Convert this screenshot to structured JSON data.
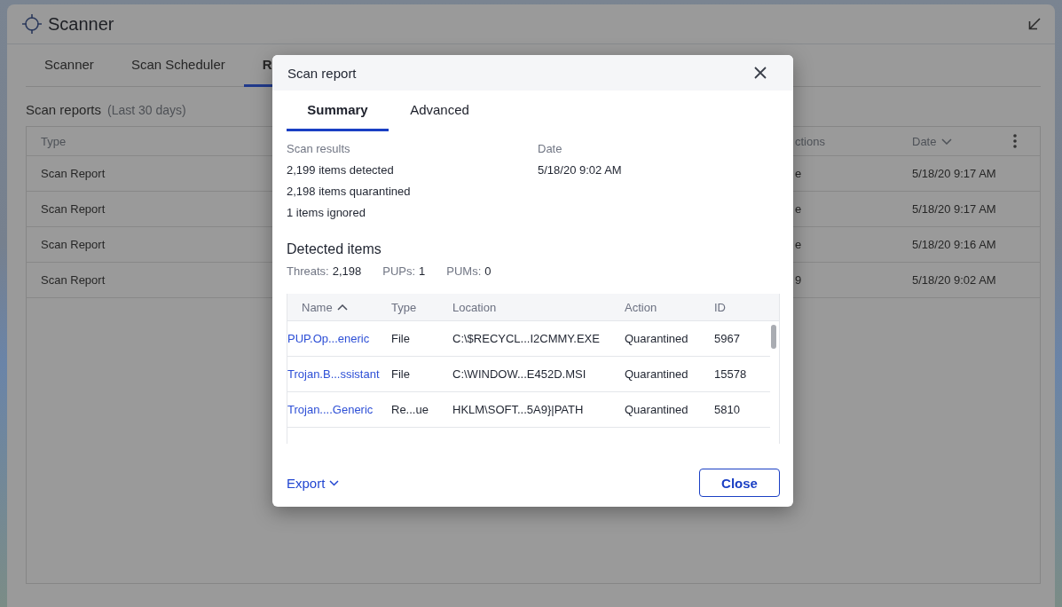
{
  "window": {
    "title": "Scanner"
  },
  "tabs": [
    {
      "label": "Scanner",
      "selected": false
    },
    {
      "label": "Scan Scheduler",
      "selected": false
    },
    {
      "label": "R",
      "selected": true
    }
  ],
  "reports": {
    "title": "Scan reports",
    "subtitle": "(Last 30 days)",
    "columns": [
      {
        "label": "Type",
        "sorted": false
      },
      {
        "label": "ctions",
        "sorted": false
      },
      {
        "label": "Date",
        "sorted": true,
        "descending": true
      }
    ],
    "rows": [
      [
        "Scan Report",
        "e",
        "5/18/20 9:17 AM"
      ],
      [
        "Scan Report",
        "e",
        "5/18/20 9:17 AM"
      ],
      [
        "Scan Report",
        "e",
        "5/18/20 9:16 AM"
      ],
      [
        "Scan Report",
        "9",
        "5/18/20 9:02 AM"
      ]
    ]
  },
  "dialog": {
    "title": "Scan report",
    "tabs": [
      {
        "label": "Summary",
        "selected": true
      },
      {
        "label": "Advanced",
        "selected": false
      }
    ],
    "scan_results": {
      "label": "Scan results",
      "lines": [
        "2,199 items detected",
        "2,198 items quarantined",
        "1 items ignored"
      ]
    },
    "date": {
      "label": "Date",
      "value": "5/18/20 9:02 AM"
    },
    "detected_items": {
      "title": "Detected items",
      "counts": [
        {
          "label": "Threats:",
          "value": "2,198"
        },
        {
          "label": "PUPs:",
          "value": "1"
        },
        {
          "label": "PUMs:",
          "value": "0"
        }
      ]
    },
    "table": {
      "columns": [
        {
          "label": "Name",
          "kind": "link",
          "sorted": true,
          "descending": false
        },
        {
          "label": "Type",
          "kind": "text",
          "sorted": false
        },
        {
          "label": "Location",
          "kind": "text",
          "sorted": false
        },
        {
          "label": "Action",
          "kind": "text",
          "sorted": false
        },
        {
          "label": "ID",
          "kind": "text",
          "sorted": false
        }
      ],
      "rows": [
        [
          "PUP.Op...eneric",
          "File",
          "C:\\$RECYCL...I2CMMY.EXE",
          "Quarantined",
          "5967"
        ],
        [
          "Trojan.B...ssistant",
          "File",
          "C:\\WINDOW...E452D.MSI",
          "Quarantined",
          "15578"
        ],
        [
          "Trojan....Generic",
          "Re...ue",
          "HKLM\\SOFT...5A9}|PATH",
          "Quarantined",
          "5810"
        ]
      ]
    },
    "export": {
      "label": "Export"
    },
    "close": {
      "label": "Close"
    }
  }
}
